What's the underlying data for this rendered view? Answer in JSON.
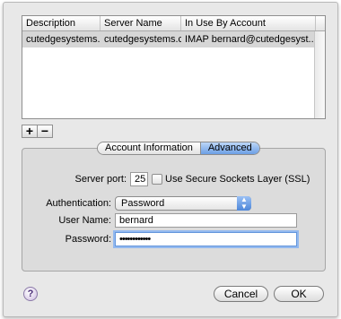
{
  "table": {
    "columns": [
      "Description",
      "Server Name",
      "In Use By Account"
    ],
    "rows": [
      {
        "description": "cutedgesystems....",
        "server": "cutedgesystems.com",
        "account": "IMAP bernard@cutedgesyst..."
      }
    ]
  },
  "buttons": {
    "add": "+",
    "remove": "−",
    "cancel": "Cancel",
    "ok": "OK",
    "help": "?"
  },
  "tabs": {
    "account_info": "Account Information",
    "advanced": "Advanced",
    "selected": "Advanced"
  },
  "form": {
    "server_port_label": "Server port:",
    "server_port_value": "25",
    "ssl_label": "Use Secure Sockets Layer (SSL)",
    "ssl_checked": false,
    "auth_label": "Authentication:",
    "auth_value": "Password",
    "username_label": "User Name:",
    "username_value": "bernard",
    "password_label": "Password:",
    "password_value": "••••••••••••"
  },
  "icons": {
    "select_arrows": "up-down-arrows-icon",
    "help": "help-icon"
  }
}
